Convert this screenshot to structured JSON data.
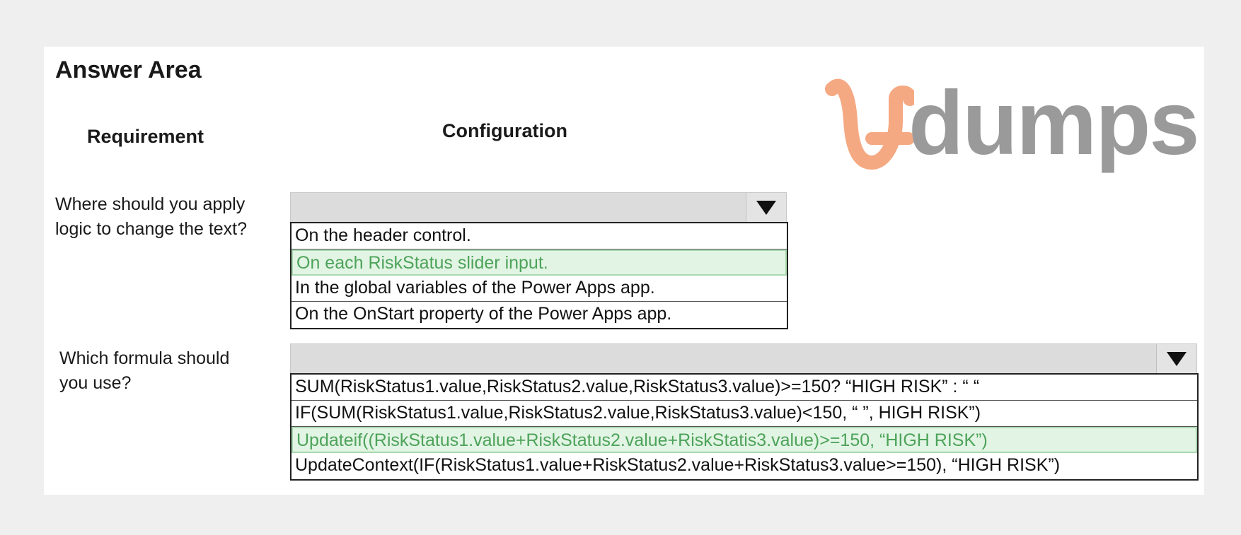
{
  "answer_area": {
    "title": "Answer Area",
    "col_requirement": "Requirement",
    "col_configuration": "Configuration"
  },
  "watermark": {
    "brand": "dumps"
  },
  "questions": [
    {
      "text_line1": "Where should you apply",
      "text_line2": "logic to change the text?",
      "options": [
        "On the header control.",
        "On each RiskStatus slider input.",
        "In the global variables of the Power Apps app.",
        "On the OnStart property of the Power Apps app."
      ],
      "selected_index": 1
    },
    {
      "text_line1": "Which formula should",
      "text_line2": "you use?",
      "options": [
        "SUM(RiskStatus1.value,RiskStatus2.value,RiskStatus3.value)>=150? “HIGH RISK” : “ “",
        "IF(SUM(RiskStatus1.value,RiskStatus2.value,RiskStatus3.value)<150, “ ”, HIGH RISK”)",
        "Updateif((RiskStatus1.value+RiskStatus2.value+RiskStatis3.value)>=150, “HIGH RISK”)",
        "UpdateContext(IF(RiskStatus1.value+RiskStatus2.value+RiskStatus3.value>=150), “HIGH RISK”)"
      ],
      "selected_index": 2
    }
  ],
  "colors": {
    "selected_bg": "#e2f4e4",
    "selected_text": "#4da35a",
    "logo_orange": "#f5a982",
    "logo_gray": "#9a9a9a"
  }
}
